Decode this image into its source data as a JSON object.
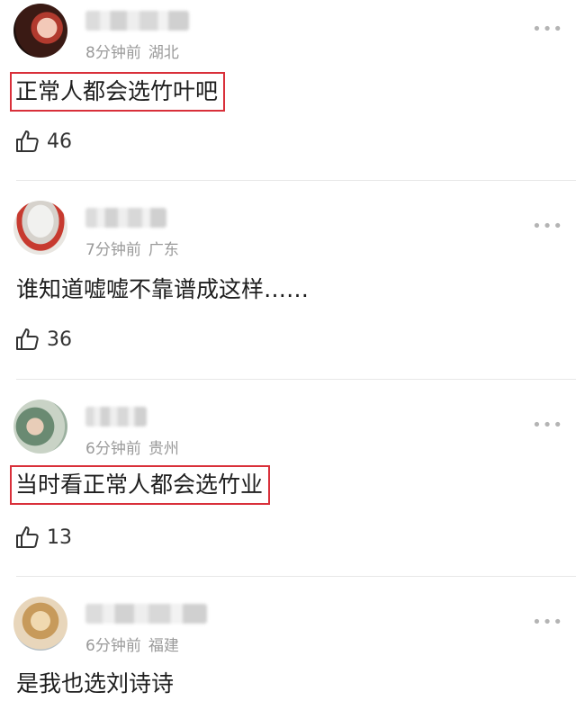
{
  "comments": [
    {
      "time": "8分钟前",
      "location": "湖北",
      "text": "正常人都会选竹叶吧",
      "likes": "46",
      "highlighted": true,
      "avatar_icon": "user-avatar-photo"
    },
    {
      "time": "7分钟前",
      "location": "广东",
      "text": "谁知道嘘嘘不靠谱成这样……",
      "likes": "36",
      "highlighted": false,
      "avatar_icon": "cat-avatar-photo"
    },
    {
      "time": "6分钟前",
      "location": "贵州",
      "text": "当时看正常人都会选竹业",
      "likes": "13",
      "highlighted": true,
      "avatar_icon": "user-avatar-photo"
    },
    {
      "time": "6分钟前",
      "location": "福建",
      "text": "是我也选刘诗诗",
      "likes": "",
      "highlighted": false,
      "avatar_icon": "user-avatar-photo"
    }
  ],
  "icons": {
    "like": "thumbs-up-icon",
    "more": "more-dots-icon"
  },
  "colors": {
    "highlight_border": "#d9303a",
    "meta": "#9a9a9a"
  }
}
